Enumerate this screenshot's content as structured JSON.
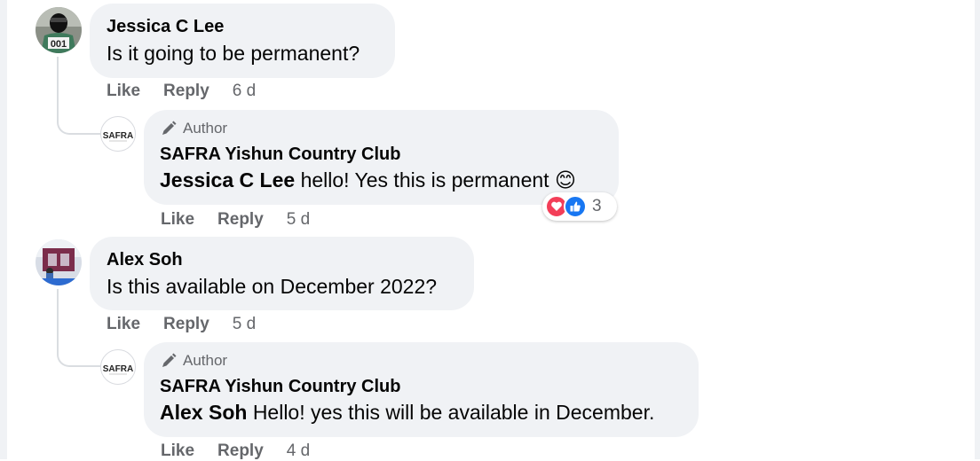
{
  "comments": [
    {
      "author": "Jessica C Lee",
      "text": "Is it going to be permanent?",
      "like_label": "Like",
      "reply_label": "Reply",
      "time": "6 d",
      "reply": {
        "badge": "Author",
        "author": "SAFRA Yishun Country Club",
        "mention": "Jessica C Lee",
        "text": "hello! Yes this is permanent 😊",
        "like_label": "Like",
        "reply_label": "Reply",
        "time": "5 d",
        "reaction_count": "3",
        "reactions": [
          "love-icon",
          "like-icon"
        ]
      }
    },
    {
      "author": "Alex Soh",
      "text": "Is this available on December 2022?",
      "like_label": "Like",
      "reply_label": "Reply",
      "time": "5 d",
      "reply": {
        "badge": "Author",
        "author": "SAFRA Yishun Country Club",
        "mention": "Alex Soh",
        "text": "Hello! yes this will be available in December.",
        "like_label": "Like",
        "reply_label": "Reply",
        "time": "4 d"
      }
    }
  ],
  "page_avatar_text": "SAFRA",
  "avatar1_jersey": "001",
  "colors": {
    "bubble": "#f0f2f5",
    "meta_text": "#65676b",
    "love": "#f33e58",
    "like": "#1877f2"
  }
}
